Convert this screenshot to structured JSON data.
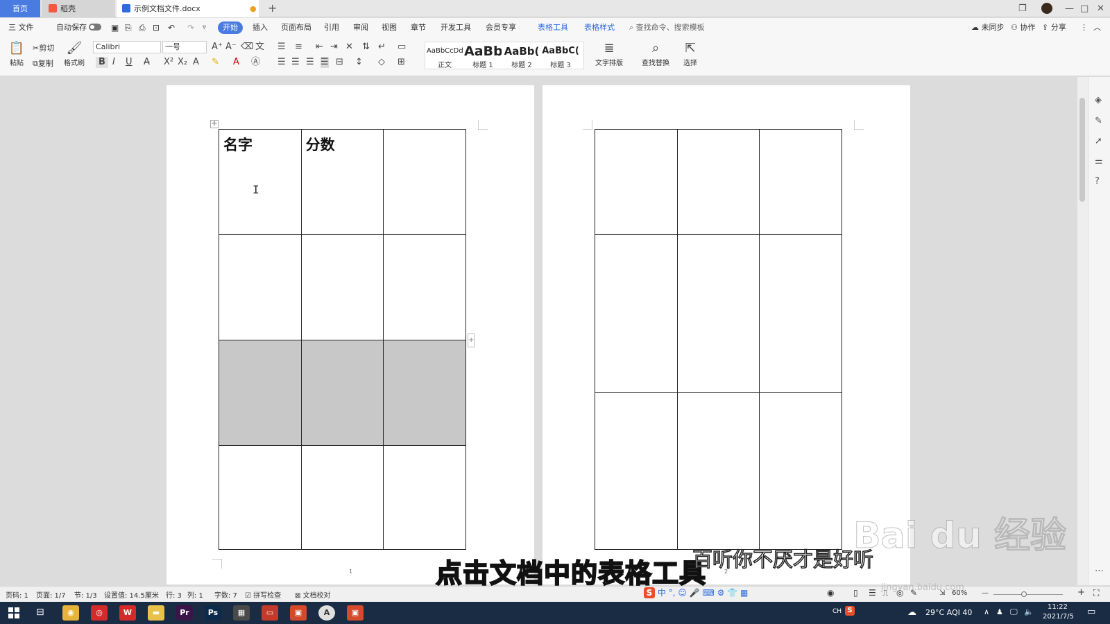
{
  "tabs": {
    "home": "首页",
    "shell": "稻壳",
    "doc": "示例文档文件.docx",
    "add": "+"
  },
  "window": {
    "restore": "❐",
    "minimize": "—",
    "maximize": "□",
    "close": "✕"
  },
  "menu": {
    "file": "三 文件",
    "autosave": "自动保存",
    "items": [
      "开始",
      "插入",
      "页面布局",
      "引用",
      "审阅",
      "视图",
      "章节",
      "开发工具",
      "会员专享",
      "表格工具",
      "表格样式"
    ],
    "active": "开始",
    "search_placeholder": "查找命令、搜索模板",
    "sync": "未同步",
    "collab": "协作",
    "share": "分享"
  },
  "ribbon": {
    "paste": "粘贴",
    "cut": "剪切",
    "copy": "复制",
    "format_painter": "格式刷",
    "font_name": "Calibri",
    "font_size": "一号",
    "bold": "B",
    "italic": "I",
    "underline": "U",
    "styles": [
      {
        "preview": "AaBbCcDd",
        "label": "正文"
      },
      {
        "preview": "AaBb",
        "label": "标题 1"
      },
      {
        "preview": "AaBb(",
        "label": "标题 2"
      },
      {
        "preview": "AaBbC(",
        "label": "标题 3"
      }
    ],
    "text_layout": "文字排版",
    "find_replace": "查找替换",
    "select": "选择"
  },
  "document": {
    "table1": {
      "rows": [
        [
          "名字",
          "分数",
          ""
        ],
        [
          "",
          "",
          ""
        ],
        [
          "",
          "",
          ""
        ],
        [
          "",
          "",
          ""
        ]
      ],
      "shaded_row": 2
    },
    "page1_num": "1",
    "page2_num": "2"
  },
  "status": {
    "page_code": "页码: 1",
    "pages": "页面: 1/7",
    "section": "节: 1/3",
    "setting": "设置值: 14.5厘米",
    "row": "行: 3",
    "col": "列: 1",
    "words": "字数: 7",
    "spell": "拼写检查",
    "proof": "文档校对",
    "zoom": "60%"
  },
  "ime": {
    "lang": "中"
  },
  "taskbar": {
    "apps": [
      {
        "icon": "chrome-icon",
        "color": "#e8b33a",
        "glyph": "◉"
      },
      {
        "icon": "netease-music-icon",
        "color": "#d42a2a",
        "glyph": "◎"
      },
      {
        "icon": "wps-icon",
        "color": "#d42a2a",
        "glyph": "W"
      },
      {
        "icon": "folder-icon",
        "color": "#e8c24a",
        "glyph": "▬"
      },
      {
        "icon": "premiere-icon",
        "color": "#3a1548",
        "glyph": "Pr"
      },
      {
        "icon": "photoshop-icon",
        "color": "#0d2a4a",
        "glyph": "Ps"
      },
      {
        "icon": "clapper-icon",
        "color": "#4a4a4a",
        "glyph": "▦"
      },
      {
        "icon": "slides-icon",
        "color": "#c23a2a",
        "glyph": "▭"
      },
      {
        "icon": "recorder-icon",
        "color": "#d44a2a",
        "glyph": "▣"
      },
      {
        "icon": "typora-icon",
        "color": "#e0e0e0",
        "glyph": "A"
      },
      {
        "icon": "screen-capture-icon",
        "color": "#d44a2a",
        "glyph": "▣"
      }
    ],
    "ch": "CH",
    "weather": "29°C AQI 40",
    "time": "11:22",
    "date": "2021/7/5"
  },
  "subtitle": "点击文档中的表格工具",
  "subtitle2": "百听你不厌才是好听",
  "watermark": "Bai du 经验",
  "watermark_url": "jingyan.baidu.com"
}
